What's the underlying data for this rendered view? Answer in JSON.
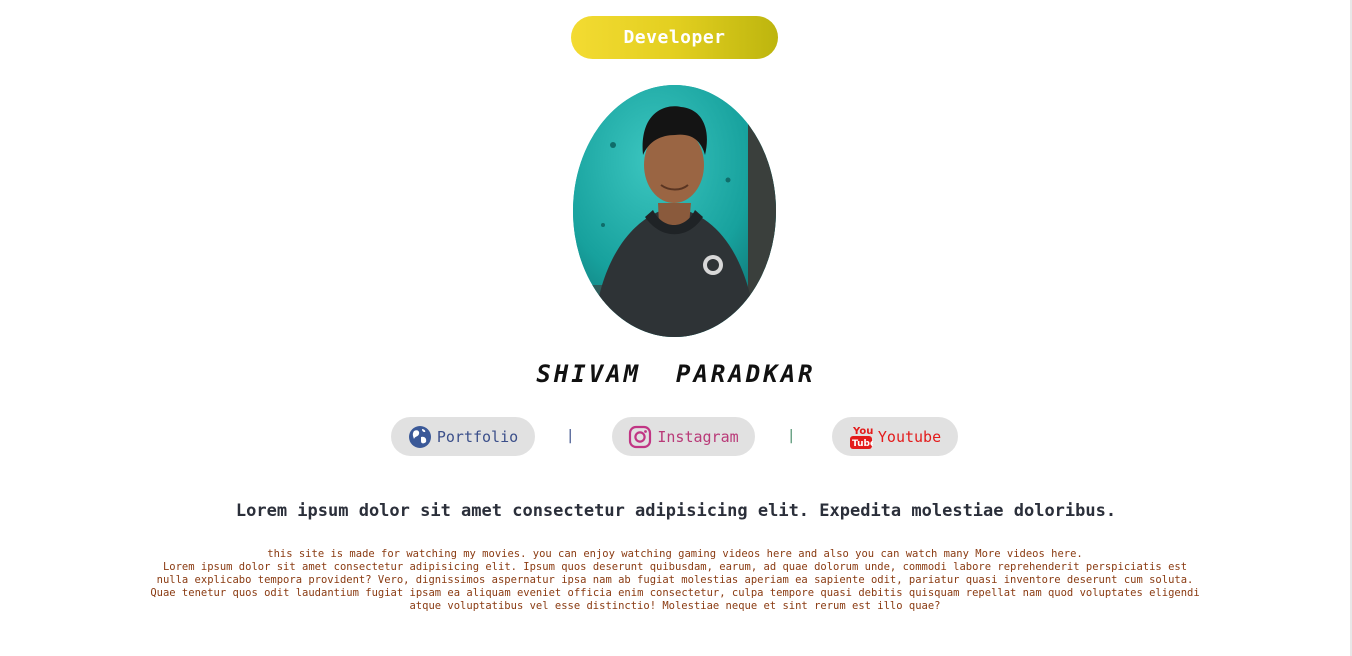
{
  "header": {
    "role_label": "Developer"
  },
  "profile": {
    "name": "SHIVAM  PARADKAR",
    "photo_icon": "profile-photo"
  },
  "links": [
    {
      "label": "Portfolio",
      "icon": "globe-icon",
      "color": "#3b4f8a"
    },
    {
      "label": "Instagram",
      "icon": "instagram-icon",
      "color": "#b93a78"
    },
    {
      "label": "Youtube",
      "icon": "youtube-icon",
      "color": "#e31b1b"
    }
  ],
  "separators": [
    "|",
    "|"
  ],
  "content": {
    "headline": "Lorem ipsum dolor sit amet consectetur adipisicing elit. Expedita molestiae doloribus.",
    "paragraph_lines": [
      "this site is made for watching my movies. you can enjoy watching gaming videos here and also you can watch many More videos here.",
      "Lorem ipsum dolor sit amet consectetur adipisicing elit. Ipsum quos deserunt quibusdam, earum, ad quae dolorum unde, commodi labore reprehenderit perspiciatis est",
      "nulla explicabo tempora provident? Vero, dignissimos aspernatur ipsa nam ab fugiat molestias aperiam ea sapiente odit, pariatur quasi inventore deserunt cum soluta.",
      "Quae tenetur quos odit laudantium fugiat ipsam ea aliquam eveniet officia enim consectetur, culpa tempore quasi debitis quisquam repellat nam quod voluptates eligendi",
      "atque voluptatibus vel esse distinctio! Molestiae neque et sint rerum est illo quae?"
    ]
  },
  "colors": {
    "accent_yellow": "#e3cf20",
    "pill_background": "#e1e1e1",
    "paragraph_text": "#8a3b12"
  }
}
